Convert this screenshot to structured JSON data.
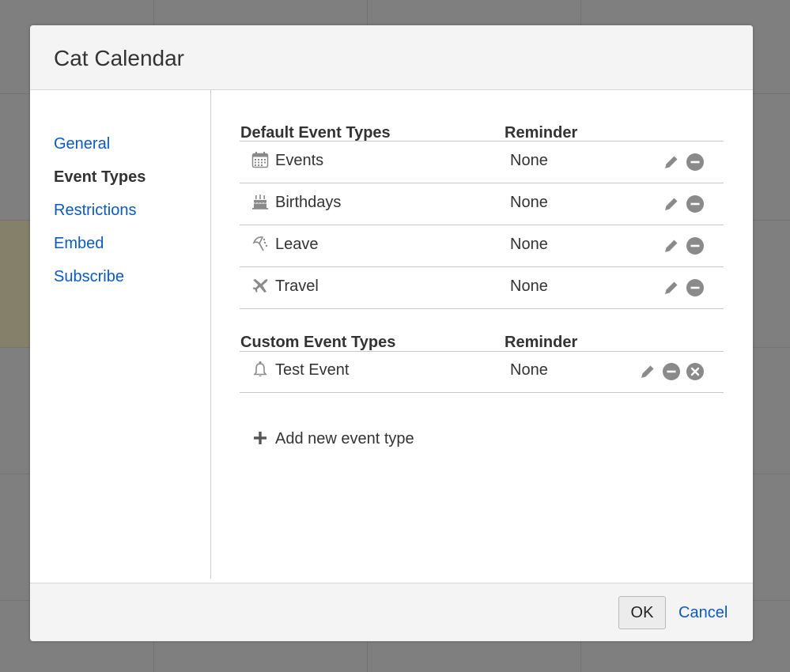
{
  "dialog": {
    "title": "Cat Calendar"
  },
  "sidebar": {
    "items": [
      {
        "label": "General",
        "active": false
      },
      {
        "label": "Event Types",
        "active": true
      },
      {
        "label": "Restrictions",
        "active": false
      },
      {
        "label": "Embed",
        "active": false
      },
      {
        "label": "Subscribe",
        "active": false
      }
    ]
  },
  "default_types": {
    "header_type": "Default Event Types",
    "header_reminder": "Reminder",
    "rows": [
      {
        "label": "Events",
        "reminder": "None",
        "icon": "calendar-icon"
      },
      {
        "label": "Birthdays",
        "reminder": "None",
        "icon": "cake-icon"
      },
      {
        "label": "Leave",
        "reminder": "None",
        "icon": "umbrella-icon"
      },
      {
        "label": "Travel",
        "reminder": "None",
        "icon": "airplane-icon"
      }
    ]
  },
  "custom_types": {
    "header_type": "Custom Event Types",
    "header_reminder": "Reminder",
    "rows": [
      {
        "label": "Test Event",
        "reminder": "None",
        "icon": "bell-icon"
      }
    ]
  },
  "add_new": {
    "label": "Add new event type",
    "icon": "plus-icon"
  },
  "footer": {
    "ok_label": "OK",
    "cancel_label": "Cancel"
  },
  "colors": {
    "link": "#0b5ac2",
    "icon_gray": "#8a8a8a",
    "backdrop": "#7f7f7f"
  }
}
